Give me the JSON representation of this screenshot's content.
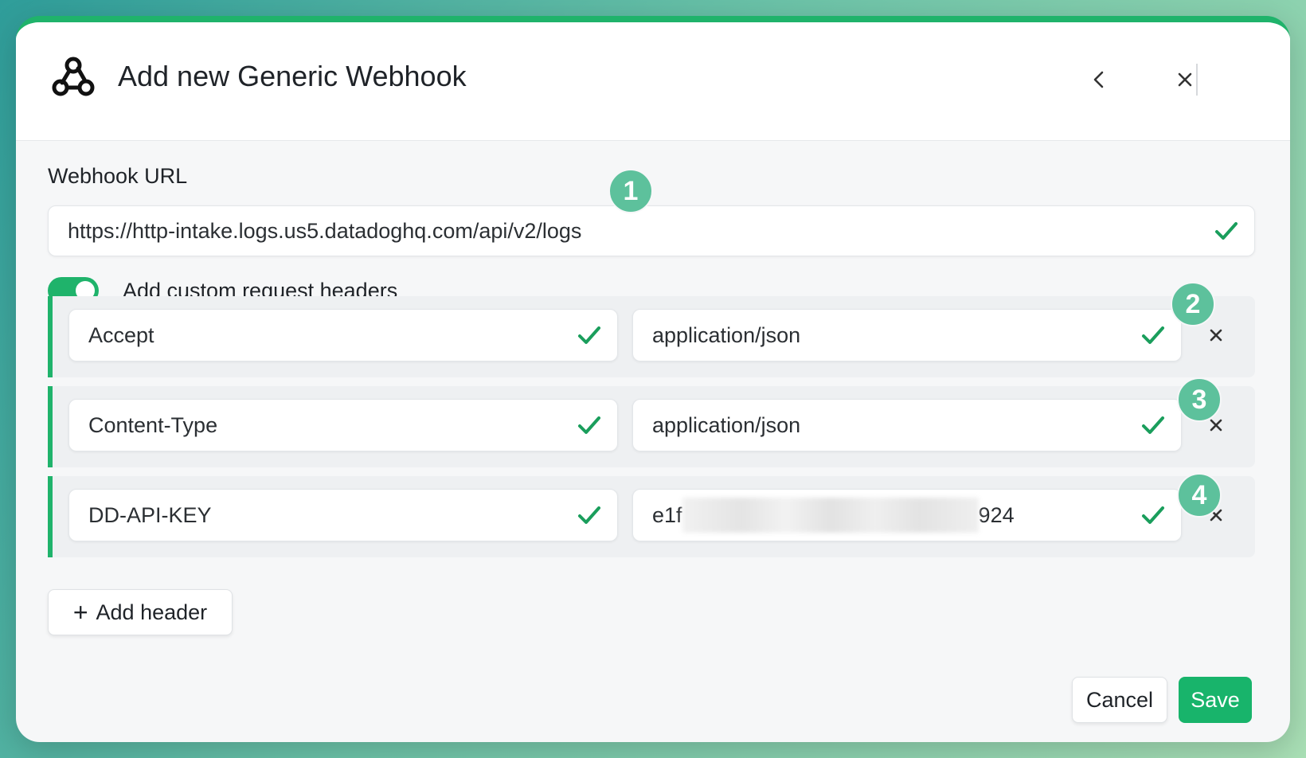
{
  "dialog": {
    "title": "Add new Generic Webhook",
    "icons": {
      "logo": "webhook-icon",
      "back": "chevron-left-icon",
      "close": "close-icon"
    }
  },
  "webhook": {
    "label": "Webhook URL",
    "value": "https://http-intake.logs.us5.datadoghq.com/api/v2/logs"
  },
  "custom_headers": {
    "toggle_label": "Add custom request headers",
    "enabled": true,
    "rows": [
      {
        "key": "Accept",
        "value": "application/json"
      },
      {
        "key": "Content-Type",
        "value": "application/json"
      },
      {
        "key": "DD-API-KEY",
        "value_prefix": "e1f",
        "value_suffix": "924"
      }
    ]
  },
  "badges": [
    "1",
    "2",
    "3",
    "4"
  ],
  "buttons": {
    "add_header": "Add header",
    "cancel": "Cancel",
    "save": "Save"
  },
  "colors": {
    "accent": "#1fb36b",
    "badge": "#5dc19c",
    "check": "#1a9e5c"
  }
}
